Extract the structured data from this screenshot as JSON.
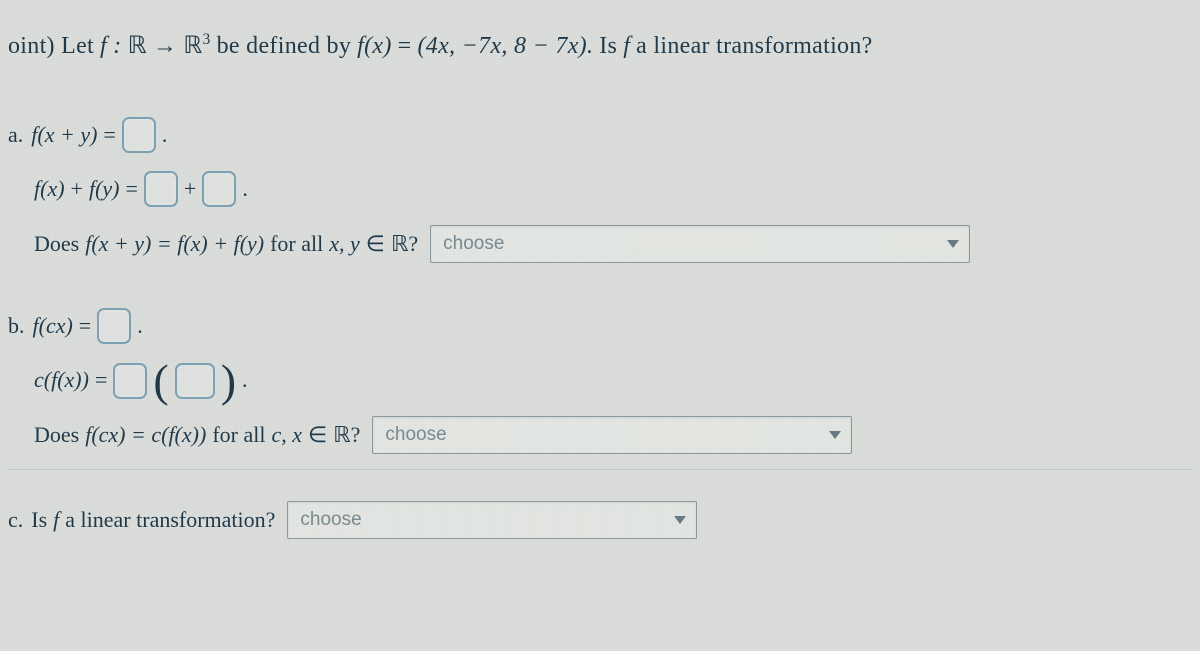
{
  "intro": {
    "prefix": "oint) Let",
    "f_colon": "f :",
    "R": "ℝ",
    "arrow": "→",
    "R3_sup": "3",
    "defined_by": "be defined by",
    "f_of_x": "f(x)",
    "eq": "=",
    "tuple_open": "(4x, −7x, 8 − 7x).",
    "question": "Is",
    "f": "f",
    "linear_q": "a linear transformation?"
  },
  "a": {
    "label": "a.",
    "lhs1": "f(x + y)",
    "eq": "=",
    "period": ".",
    "lhs2a": "f(x)",
    "plus_word": "+",
    "lhs2b": "f(y)",
    "plus": "+",
    "does": "Does",
    "cond": "f(x + y) = f(x) + f(y)",
    "forall": "for all",
    "xy": "x, y",
    "in": "∈",
    "R": "ℝ?",
    "choose": "choose"
  },
  "b": {
    "label": "b.",
    "lhs1": "f(cx)",
    "eq": "=",
    "period": ".",
    "lhs2": "c(f(x))",
    "open": "(",
    "close": ")",
    "does": "Does",
    "cond": "f(cx) = c(f(x))",
    "forall": "for all",
    "cx": "c, x",
    "in": "∈",
    "R": "ℝ?",
    "choose": "choose"
  },
  "c": {
    "label": "c.",
    "is": "Is",
    "f": "f",
    "linear": "a linear transformation?",
    "choose": "choose"
  }
}
